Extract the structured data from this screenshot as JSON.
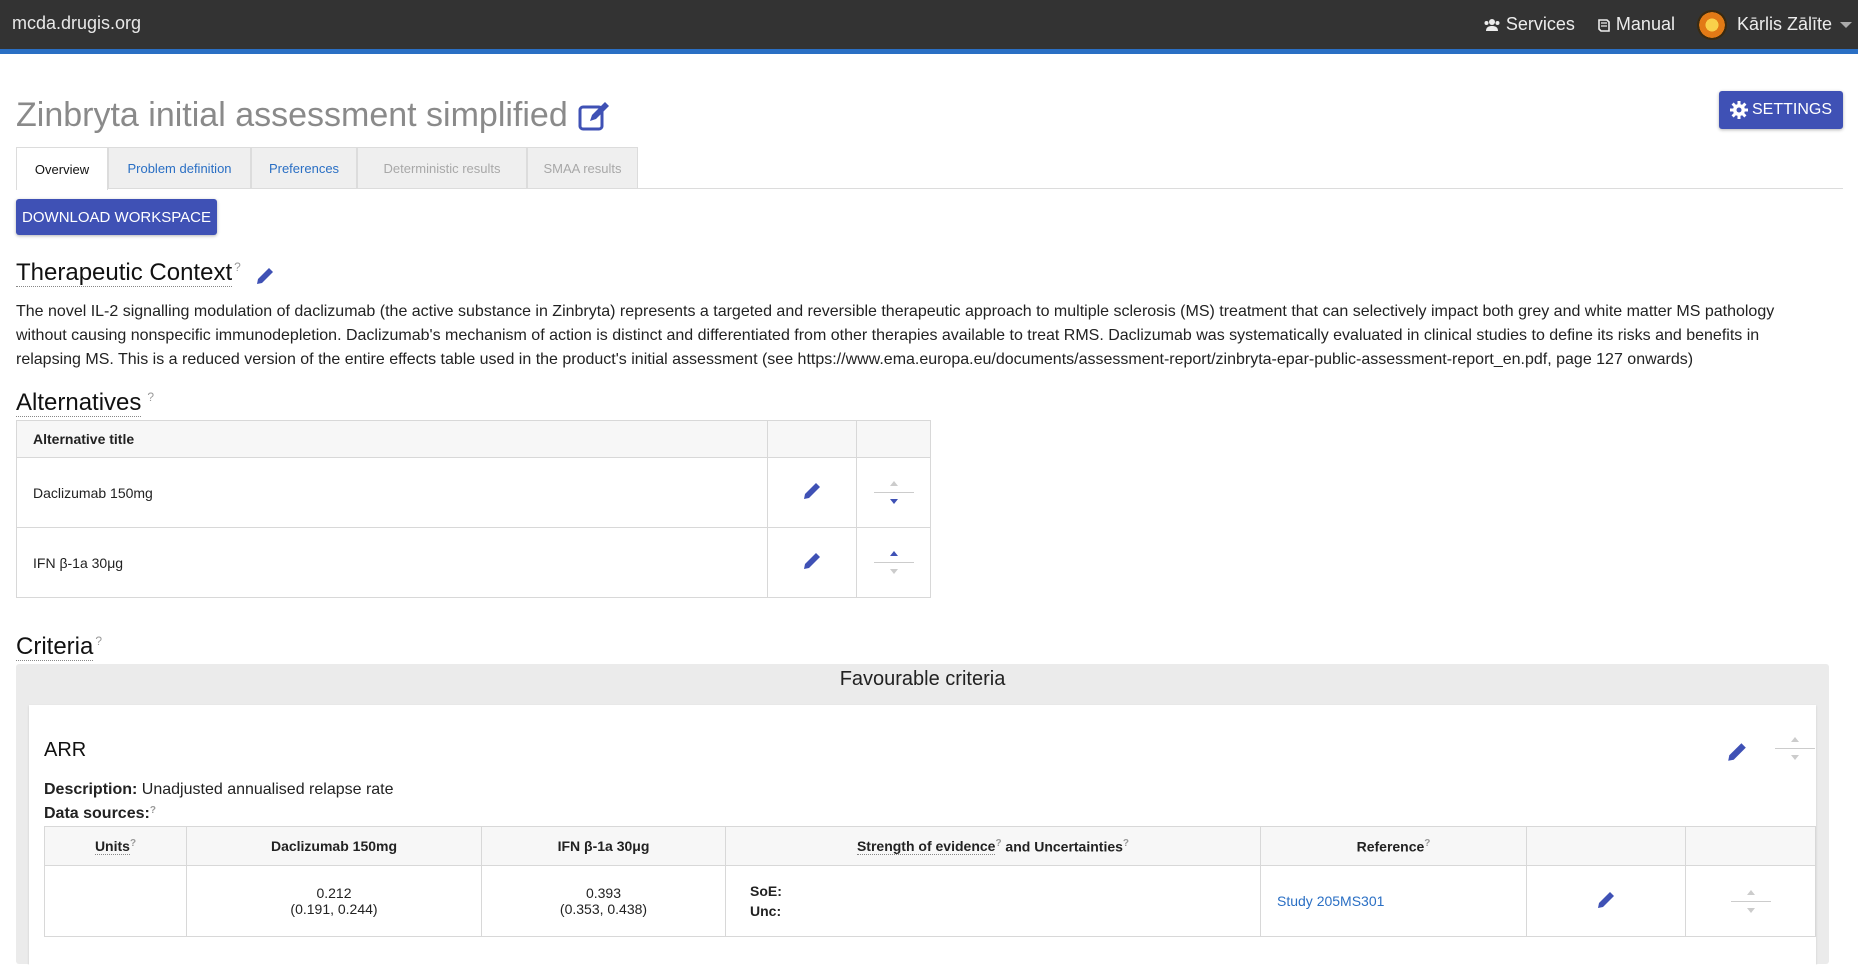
{
  "topbar": {
    "brand": "mcda.drugis.org",
    "services": "Services",
    "manual": "Manual",
    "user": "Kārlis Zālīte"
  },
  "page": {
    "title": "Zinbryta initial assessment simplified",
    "settings_label": "SETTINGS",
    "download_label": "DOWNLOAD WORKSPACE"
  },
  "tabs": [
    {
      "label": "Overview",
      "state": "active"
    },
    {
      "label": "Problem definition",
      "state": "link"
    },
    {
      "label": "Preferences",
      "state": "link"
    },
    {
      "label": "Deterministic results",
      "state": "disabled"
    },
    {
      "label": "SMAA results",
      "state": "disabled"
    }
  ],
  "therapeutic_context": {
    "title": "Therapeutic Context",
    "help": "?",
    "text": "The novel IL-2 signalling modulation of daclizumab (the active substance in Zinbryta) represents a targeted and reversible therapeutic approach to multiple sclerosis (MS) treatment that can selectively impact both grey and white matter MS pathology without causing nonspecific immunodepletion. Daclizumab's mechanism of action is distinct and differentiated from other therapies available to treat RMS. Daclizumab was systematically evaluated in clinical studies to define its risks and benefits in relapsing MS. This is a reduced version of the entire effects table used in the product's initial assessment (see https://www.ema.europa.eu/documents/assessment-report/zinbryta-epar-public-assessment-report_en.pdf, page 127 onwards)"
  },
  "alternatives": {
    "title": "Alternatives",
    "help": "?",
    "column_header": "Alternative title",
    "items": [
      {
        "title": "Daclizumab 150mg"
      },
      {
        "title": "IFN β-1a 30μg"
      }
    ]
  },
  "criteria": {
    "title": "Criteria",
    "help": "?",
    "group_heading": "Favourable criteria",
    "items": [
      {
        "name": "ARR",
        "description_label": "Description:",
        "description": "Unadjusted annualised relapse rate",
        "data_sources_label": "Data sources:",
        "table": {
          "headers": {
            "units": "Units",
            "alt1": "Daclizumab 150mg",
            "alt2": "IFN β-1a 30μg",
            "soe_unc_a": "Strength of evidence",
            "soe_unc_b": " and Uncertainties",
            "reference": "Reference"
          },
          "row": {
            "units": "",
            "alt1_value": "0.212",
            "alt1_ci": "(0.191, 0.244)",
            "alt2_value": "0.393",
            "alt2_ci": "(0.353, 0.438)",
            "soe_label": "SoE:",
            "unc_label": "Unc:",
            "reference": "Study 205MS301"
          }
        }
      }
    ]
  }
}
